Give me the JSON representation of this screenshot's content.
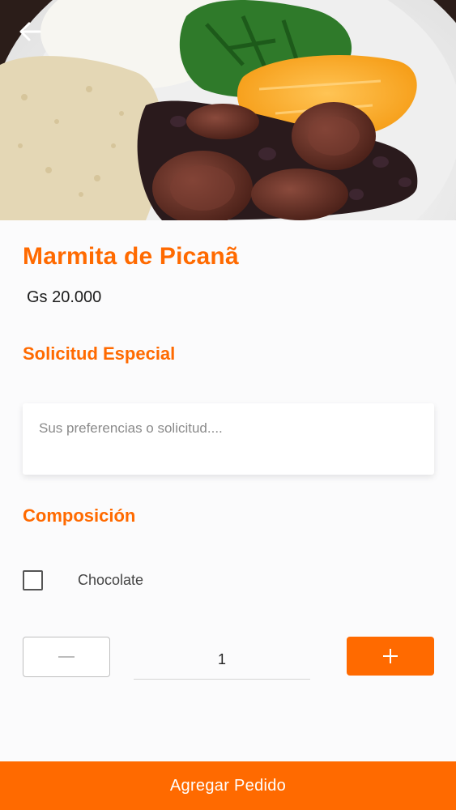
{
  "product": {
    "name": "Marmita de Picanã",
    "price": "Gs 20.000"
  },
  "special_request": {
    "title": "Solicitud Especial",
    "placeholder": "Sus preferencias o solicitud....",
    "value": ""
  },
  "composition": {
    "title": "Composición",
    "options": [
      {
        "label": "Chocolate",
        "checked": false
      }
    ]
  },
  "quantity": {
    "value": "1",
    "decrement_icon": "minus-icon",
    "increment_icon": "plus-icon"
  },
  "actions": {
    "add_order_label": "Agregar Pedido"
  },
  "colors": {
    "accent": "#ff6a00",
    "background": "#fbfbfc"
  }
}
